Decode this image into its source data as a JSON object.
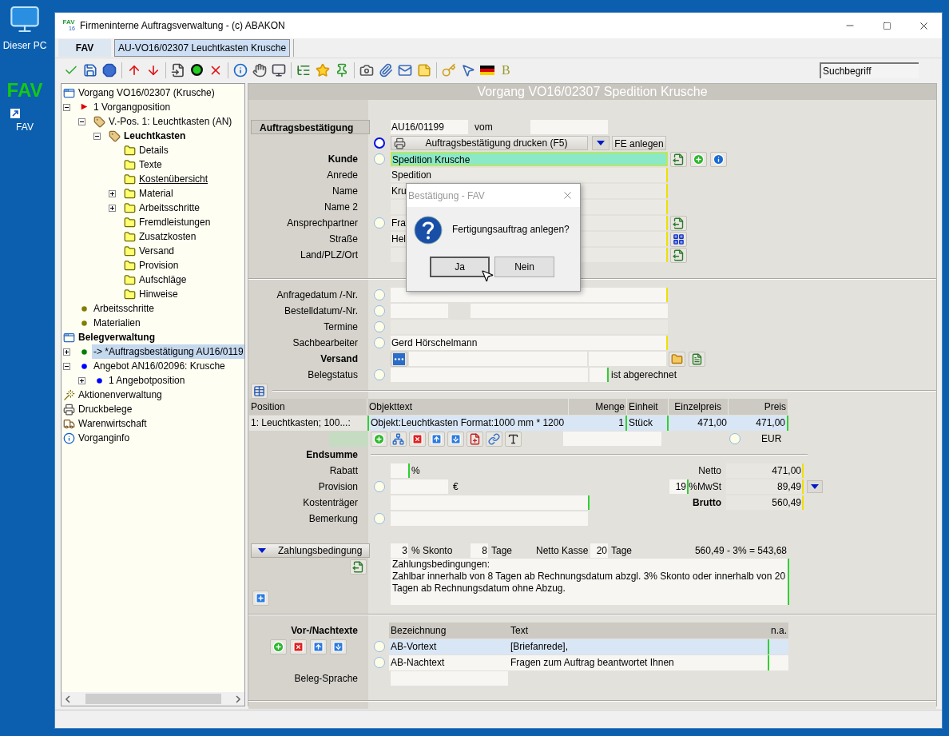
{
  "desktop": [
    {
      "kind": "computer",
      "label": "Dieser PC"
    },
    {
      "kind": "shortcut",
      "logo": "FAV",
      "label": "FAV"
    }
  ],
  "window": {
    "title": "Firmeninterne Auftragsverwaltung - (c) ABAKON",
    "icon_text": "FAV",
    "icon_subtext": "16"
  },
  "tabs": [
    {
      "label": "FAV",
      "selected": false
    },
    {
      "label": "AU-VO16/02307 Leuchtkasten Krusche",
      "selected": true
    }
  ],
  "toolbar": {
    "format_button": "B",
    "search": {
      "placeholder": "Suchbegriff"
    }
  },
  "tree": [
    {
      "label": "Vorgang VO16/02307 (Krusche)",
      "selected": false,
      "children": [
        {
          "label": "1 Vorgangposition",
          "expanded": true,
          "selected": false,
          "children": [
            {
              "label": "V.-Pos. 1: Leuchtkasten (AN)",
              "expanded": true,
              "selected": false,
              "children": [
                {
                  "label": "Leuchtkasten",
                  "expanded": true,
                  "selected": false,
                  "children": [
                    {
                      "label": "Details",
                      "selected": false
                    },
                    {
                      "label": "Texte",
                      "selected": false
                    },
                    {
                      "label": "Kostenübersicht",
                      "selected": false
                    },
                    {
                      "label": "Material",
                      "expanded": false,
                      "selected": false
                    },
                    {
                      "label": "Arbeitsschritte",
                      "expanded": false,
                      "selected": false
                    },
                    {
                      "label": "Fremdleistungen",
                      "selected": false
                    },
                    {
                      "label": "Zusatzkosten",
                      "selected": false
                    },
                    {
                      "label": "Versand",
                      "selected": false
                    },
                    {
                      "label": "Provision",
                      "selected": false
                    },
                    {
                      "label": "Aufschläge",
                      "selected": false
                    },
                    {
                      "label": "Hinweise",
                      "selected": false
                    }
                  ]
                }
              ]
            }
          ]
        },
        {
          "label": "Arbeitsschritte",
          "color": "#808000",
          "selected": false
        },
        {
          "label": "Materialien",
          "color": "#808000",
          "selected": false
        }
      ]
    },
    {
      "label": "Belegverwaltung",
      "selected": false,
      "children": [
        {
          "label": "-> *Auftragsbestätigung AU16/0119",
          "color": "#008000",
          "expanded": false,
          "selected": true
        },
        {
          "label": "Angebot AN16/02096: Krusche",
          "color": "#0000ff",
          "expanded": true,
          "selected": false,
          "children": [
            {
              "label": "1 Angebotposition",
              "color": "#0000ff",
              "expanded": false,
              "selected": false
            }
          ]
        }
      ]
    },
    {
      "label": "Aktionenverwaltung",
      "selected": false
    },
    {
      "label": "Druckbelege",
      "selected": false
    },
    {
      "label": "Warenwirtschaft",
      "selected": false
    },
    {
      "label": "Vorganginfo",
      "selected": false
    }
  ],
  "form": {
    "header": "Vorgang VO16/02307 Spedition Krusche",
    "document": {
      "section": "Auftragsbestätigung",
      "number": "AU16/01199",
      "date_label": "vom"
    },
    "print": {
      "radio_selected": true,
      "button": "Auftragsbestätigung drucken (F5)",
      "fe_button": "FE anlegen"
    },
    "address": [
      {
        "label": "Kunde",
        "strong": true,
        "radio_selected": false,
        "value": "Spedition Krusche",
        "highlight": true
      },
      {
        "label": "Anrede",
        "strong": false,
        "value": "Spedition",
        "highlight": false
      },
      {
        "label": "Name",
        "strong": false,
        "value": "Kru",
        "highlight": false
      },
      {
        "label": "Name 2",
        "strong": false,
        "highlight": false
      },
      {
        "label": "Ansprechpartner",
        "strong": false,
        "radio_selected": false,
        "value": "Fra",
        "highlight": false
      },
      {
        "label": "Straße",
        "strong": false,
        "value": "Hel",
        "highlight": false
      },
      {
        "label": "Land/PLZ/Ort",
        "strong": false,
        "highlight": false
      }
    ],
    "details": [
      {
        "label": "Anfragedatum /-Nr.",
        "strong": false,
        "radio_selected": false,
        "kind": "single"
      },
      {
        "label": "Bestelldatum/-Nr.",
        "strong": false,
        "radio_selected": false,
        "kind": "pair"
      },
      {
        "label": "Termine",
        "strong": false,
        "radio_selected": false,
        "kind": "readonly"
      },
      {
        "label": "Sachbearbeiter",
        "strong": false,
        "radio_selected": false,
        "kind": "single",
        "value": "Gerd Hörschelmann"
      },
      {
        "label": "Versand",
        "strong": true,
        "kind": "shipping"
      },
      {
        "label": "Belegstatus",
        "strong": false,
        "radio_selected": false,
        "kind": "status",
        "note": "ist abgerechnet"
      }
    ],
    "positions": {
      "columns": [
        "Position",
        "Objekttext",
        "Menge",
        "Einheit",
        "Einzelpreis",
        "Preis"
      ],
      "rows": [
        {
          "selected": true,
          "cells": [
            "1: Leuchtkasten; 100...:",
            "Objekt:Leuchtkasten Format:1000 mm * 1200",
            "1",
            "Stück",
            "471,00",
            "471,00"
          ]
        }
      ],
      "currency_radio_selected": false,
      "currency": "EUR"
    },
    "totals": {
      "title": "Endsumme",
      "rabatt_label": "Rabatt",
      "rabatt_unit": "%",
      "provision_label": "Provision",
      "provision_radio_selected": false,
      "provision_unit": "€",
      "kostentraeger_label": "Kostenträger",
      "bemerkung_label": "Bemerkung",
      "bemerkung_radio_selected": false,
      "netto_label": "Netto",
      "netto": "471,00",
      "vat_rate": "19",
      "vat_label": "%MwSt",
      "vat": "89,49",
      "brutto_label": "Brutto",
      "brutto": "560,49"
    },
    "payment": {
      "button": "Zahlungsbedingung",
      "skonto": "3",
      "skonto_label": "% Skonto",
      "days": "8",
      "days_label": "Tage",
      "net_label": "Netto Kasse",
      "net_days": "20",
      "net_days_label": "Tage",
      "calc": "560,49 - 3% = 543,68",
      "text": "Zahlungsbedingungen:\nZahlbar innerhalb von 8 Tagen ab Rechnungsdatum abzgl. 3% Skonto oder innerhalb von 20 Tagen ab Rechnungsdatum ohne Abzug."
    },
    "texts": {
      "title": "Vor-/Nachtexte",
      "columns": [
        "Bezeichnung",
        "Text",
        "n.a."
      ],
      "rows": [
        {
          "selected": true,
          "radio_selected": false,
          "name": "AB-Vortext",
          "text": "[Briefanrede],"
        },
        {
          "selected": false,
          "radio_selected": false,
          "name": "AB-Nachtext",
          "text": "Fragen zum Auftrag beantwortet Ihnen"
        }
      ],
      "language_label": "Beleg-Sprache"
    }
  },
  "dialog": {
    "title": "Bestätigung - FAV",
    "message": "Fertigungsauftrag anlegen?",
    "buttons": [
      {
        "label": "Ja",
        "focused": true
      },
      {
        "label": "Nein",
        "focused": false
      }
    ]
  }
}
